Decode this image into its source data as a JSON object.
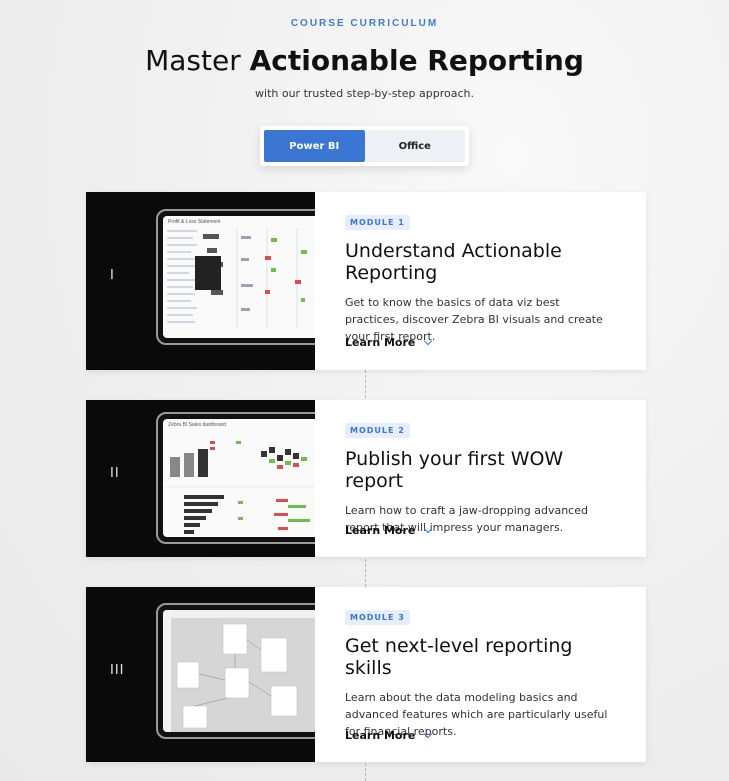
{
  "header": {
    "eyebrow": "COURSE CURRICULUM",
    "title_light": "Master ",
    "title_bold": "Actionable Reporting",
    "subtitle": "with our trusted step-by-step approach."
  },
  "toggle": {
    "options": [
      "Power BI",
      "Office"
    ],
    "selected": "Power BI"
  },
  "modules": [
    {
      "numeral": "I",
      "badge": "MODULE 1",
      "title": "Understand Actionable Reporting",
      "description": "Get to know the basics of data viz best practices, discover Zebra BI visuals and create your first report.",
      "link": "Learn More",
      "screen_title": "Profit & Loss Statement"
    },
    {
      "numeral": "II",
      "badge": "MODULE 2",
      "title": "Publish your first WOW report",
      "description": "Learn how to craft a jaw-dropping advanced report that will impress your managers.",
      "link": "Learn More",
      "screen_title": "Zebra BI Sales dashboard"
    },
    {
      "numeral": "III",
      "badge": "MODULE 3",
      "title": "Get next-level reporting skills",
      "description": "Learn about the data modeling basics and advanced features which are particularly useful for financial reports.",
      "link": "Learn More",
      "screen_title": ""
    }
  ],
  "colors": {
    "accent": "#3a76d2",
    "badge_bg": "#e6eefb",
    "media_bg": "#0a0a0a"
  }
}
